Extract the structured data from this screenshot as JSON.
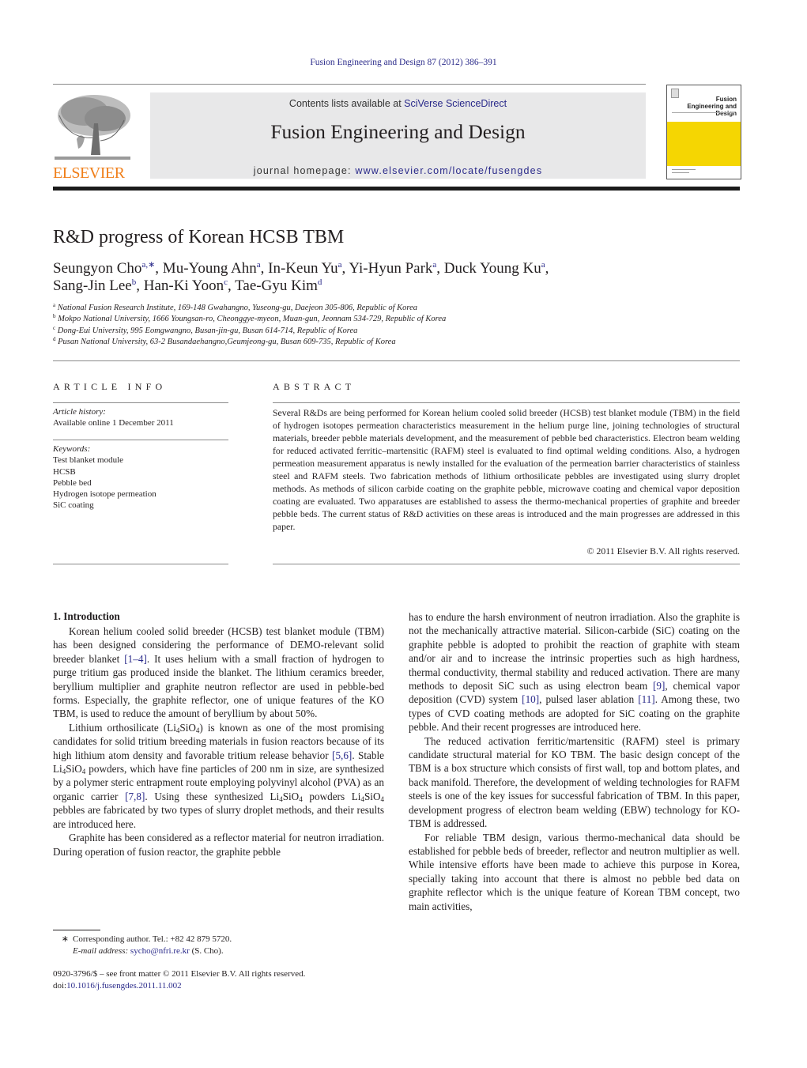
{
  "header": {
    "journal_reference": "Fusion Engineering and Design 87 (2012) 386–391",
    "publisher_logo_text": "ELSEVIER",
    "contents_prefix": "Contents lists available at ",
    "contents_link": "SciVerse ScienceDirect",
    "journal_title": "Fusion Engineering and Design",
    "homepage_prefix": "journal homepage: ",
    "homepage_link": "www.elsevier.com/locate/fusengdes",
    "cover_title": "Fusion Engineering and Design",
    "colors": {
      "publisher_orange": "#f07f1a",
      "cover_yellow": "#f5d602",
      "link_blue": "#2a2a8a",
      "banner_gray": "#e8e8e9"
    }
  },
  "article": {
    "title": "R&D progress of Korean HCSB TBM",
    "authors": [
      {
        "name": "Seungyon Cho",
        "sup": "a,∗",
        "sep": ", "
      },
      {
        "name": "Mu-Young Ahn",
        "sup": "a",
        "sep": ", "
      },
      {
        "name": "In-Keun Yu",
        "sup": "a",
        "sep": ", "
      },
      {
        "name": "Yi-Hyun Park",
        "sup": "a",
        "sep": ", "
      },
      {
        "name": "Duck Young Ku",
        "sup": "a",
        "sep": ","
      },
      {
        "name": "Sang-Jin Lee",
        "sup": "b",
        "sep": ", "
      },
      {
        "name": "Han-Ki Yoon",
        "sup": "c",
        "sep": ", "
      },
      {
        "name": "Tae-Gyu Kim",
        "sup": "d",
        "sep": ""
      }
    ],
    "affiliations": [
      {
        "mark": "a",
        "text": "National Fusion Research Institute, 169-148 Gwahangno, Yuseong-gu, Daejeon 305-806, Republic of Korea"
      },
      {
        "mark": "b",
        "text": "Mokpo National University, 1666 Youngsan-ro, Cheonggye-myeon, Muan-gun, Jeonnam 534-729, Republic of Korea"
      },
      {
        "mark": "c",
        "text": "Dong-Eui University, 995 Eomgwangno, Busan-jin-gu, Busan 614-714, Republic of Korea"
      },
      {
        "mark": "d",
        "text": "Pusan National University, 63-2 Busandaehangno,Geumjeong-gu, Busan 609-735, Republic of Korea"
      }
    ]
  },
  "article_info": {
    "heading": "ARTICLE INFO",
    "history_label": "Article history:",
    "history_value": "Available online 1 December 2011",
    "keywords_label": "Keywords:",
    "keywords": [
      "Test blanket module",
      "HCSB",
      "Pebble bed",
      "Hydrogen isotope permeation",
      "SiC coating"
    ]
  },
  "abstract": {
    "heading": "ABSTRACT",
    "text": "Several R&Ds are being performed for Korean helium cooled solid breeder (HCSB) test blanket module (TBM) in the field of hydrogen isotopes permeation characteristics measurement in the helium purge line, joining technologies of structural materials, breeder pebble materials development, and the measurement of pebble bed characteristics. Electron beam welding for reduced activated ferritic–martensitic (RAFM) steel is evaluated to find optimal welding conditions. Also, a hydrogen permeation measurement apparatus is newly installed for the evaluation of the permeation barrier characteristics of stainless steel and RAFM steels. Two fabrication methods of lithium orthosilicate pebbles are investigated using slurry droplet methods. As methods of silicon carbide coating on the graphite pebble, microwave coating and chemical vapor deposition coating are evaluated. Two apparatuses are established to assess the thermo-mechanical properties of graphite and breeder pebble beds. The current status of R&D activities on these areas is introduced and the main progresses are addressed in this paper.",
    "copyright": "© 2011 Elsevier B.V. All rights reserved."
  },
  "body": {
    "section_heading": "1.  Introduction",
    "left_paragraphs": [
      [
        {
          "t": "Korean helium cooled solid breeder (HCSB) test blanket module (TBM) has been designed considering the performance of DEMO-relevant solid breeder blanket "
        },
        {
          "link": "[1–4]"
        },
        {
          "t": ". It uses helium with a small fraction of hydrogen to purge tritium gas produced inside the blanket. The lithium ceramics breeder, beryllium multiplier and graphite neutron reflector are used in pebble-bed forms. Especially, the graphite reflector, one of unique features of the KO TBM, is used to reduce the amount of beryllium by about 50%."
        }
      ],
      [
        {
          "t": "Lithium orthosilicate (Li"
        },
        {
          "sub": "4"
        },
        {
          "t": "SiO"
        },
        {
          "sub": "4"
        },
        {
          "t": ") is known as one of the most promising candidates for solid tritium breeding materials in fusion reactors because of its high lithium atom density and favorable tritium release behavior "
        },
        {
          "link": "[5,6]"
        },
        {
          "t": ". Stable Li"
        },
        {
          "sub": "4"
        },
        {
          "t": "SiO"
        },
        {
          "sub": "4"
        },
        {
          "t": " powders, which have fine particles of 200 nm in size, are synthesized by a polymer steric entrapment route employing polyvinyl alcohol (PVA) as an organic carrier "
        },
        {
          "link": "[7,8]"
        },
        {
          "t": ". Using these synthesized Li"
        },
        {
          "sub": "4"
        },
        {
          "t": "SiO"
        },
        {
          "sub": "4"
        },
        {
          "t": " powders Li"
        },
        {
          "sub": "4"
        },
        {
          "t": "SiO"
        },
        {
          "sub": "4"
        },
        {
          "t": " pebbles are fabricated by two types of slurry droplet methods, and their results are introduced here."
        }
      ],
      [
        {
          "t": "Graphite has been considered as a reflector material for neutron irradiation. During operation of fusion reactor, the graphite pebble"
        }
      ]
    ],
    "right_paragraphs": [
      [
        {
          "t": "has to endure the harsh environment of neutron irradiation. Also the graphite is not the mechanically attractive material. Silicon-carbide (SiC) coating on the graphite pebble is adopted to prohibit the reaction of graphite with steam and/or air and to increase the intrinsic properties such as high hardness, thermal conductivity, thermal stability and reduced activation. There are many methods to deposit SiC such as using electron beam "
        },
        {
          "link": "[9]"
        },
        {
          "t": ", chemical vapor deposition (CVD) system "
        },
        {
          "link": "[10]"
        },
        {
          "t": ", pulsed laser ablation "
        },
        {
          "link": "[11]"
        },
        {
          "t": ". Among these, two types of CVD coating methods are adopted for SiC coating on the graphite pebble. And their recent progresses are introduced here."
        }
      ],
      [
        {
          "t": "The reduced activation ferritic/martensitic (RAFM) steel is primary candidate structural material for KO TBM. The basic design concept of the TBM is a box structure which consists of first wall, top and bottom plates, and back manifold. Therefore, the development of welding technologies for RAFM steels is one of the key issues for successful fabrication of TBM. In this paper, development progress of electron beam welding (EBW) technology for KO-TBM is addressed."
        }
      ],
      [
        {
          "t": "For reliable TBM design, various thermo-mechanical data should be established for pebble beds of breeder, reflector and neutron multiplier as well. While intensive efforts have been made to achieve this purpose in Korea, specially taking into account that there is almost no pebble bed data on graphite reflector which is the unique feature of Korean TBM concept, two main activities,"
        }
      ]
    ]
  },
  "footnotes": {
    "star": "∗",
    "corresponding": "Corresponding author. Tel.: +82 42 879 5720.",
    "email_label": "E-mail address:",
    "email": "sycho@nfri.re.kr",
    "email_suffix": " (S. Cho).",
    "issn_line": "0920-3796/$ – see front matter © 2011 Elsevier B.V. All rights reserved.",
    "doi_prefix": "doi:",
    "doi": "10.1016/j.fusengdes.2011.11.002"
  }
}
